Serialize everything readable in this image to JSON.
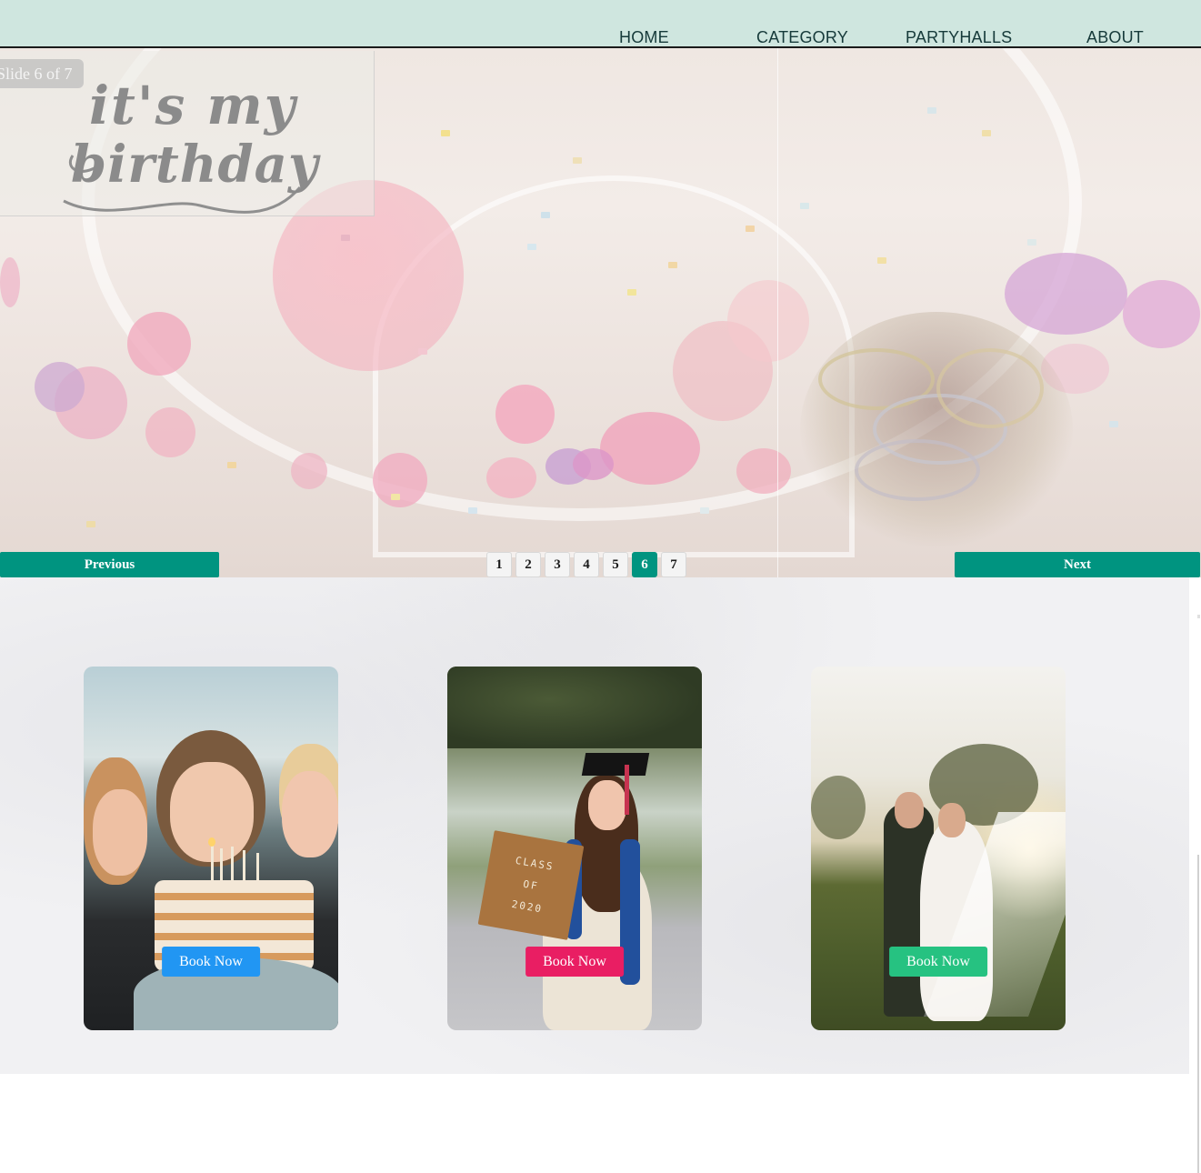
{
  "nav": {
    "items": [
      {
        "label": "HOME"
      },
      {
        "label": "CATEGORY"
      },
      {
        "label": "PARTYHALLS"
      },
      {
        "label": "ABOUT"
      }
    ]
  },
  "slider": {
    "counter": "Slide 6 of 7",
    "logo_line1": "it's my",
    "logo_line2": "birthday",
    "previous_label": "Previous",
    "next_label": "Next",
    "pages": [
      "1",
      "2",
      "3",
      "4",
      "5",
      "6",
      "7"
    ],
    "current_page": 6,
    "accent_color": "#009480"
  },
  "cards": [
    {
      "name": "birthday",
      "button_label": "Book Now",
      "button_color": "#2196f3"
    },
    {
      "name": "graduation",
      "button_label": "Book Now",
      "button_color": "#e91e63",
      "sign_lines": [
        "CLASS",
        "OF",
        "2020"
      ]
    },
    {
      "name": "wedding",
      "button_label": "Book Now",
      "button_color": "#26c281"
    }
  ],
  "colors": {
    "header_bg": "#cfe6df",
    "nav_text": "#163a3a"
  }
}
